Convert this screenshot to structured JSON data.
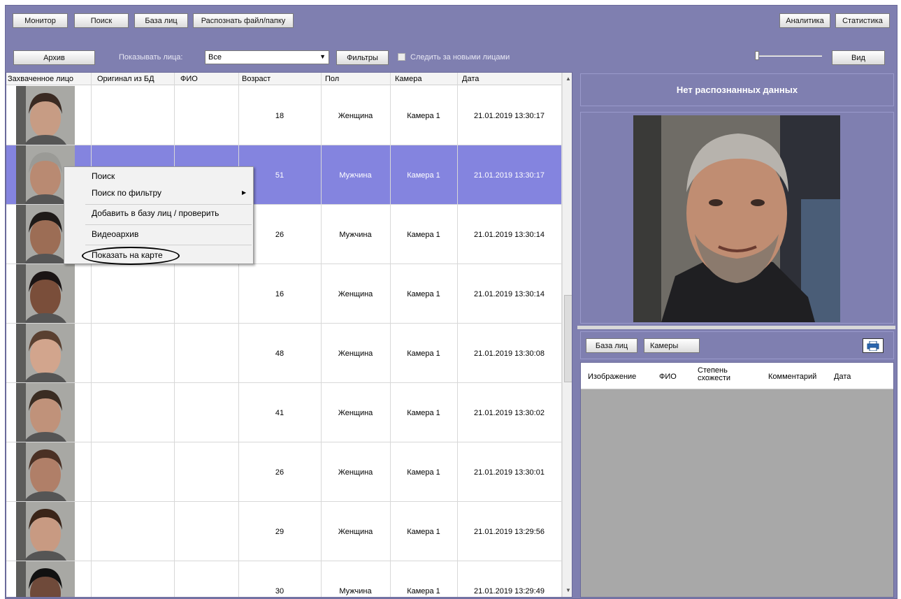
{
  "toolbar": {
    "monitor": "Монитор",
    "search": "Поиск",
    "face_db": "База лиц",
    "recognize": "Распознать файл/папку",
    "analytics": "Аналитика",
    "statistics": "Статистика"
  },
  "filterbar": {
    "archive": "Архив",
    "show_faces_label": "Показывать лица:",
    "show_faces_value": "Все",
    "filters": "Фильтры",
    "follow_new_label": "Следить за новыми лицами",
    "follow_new_checked": false,
    "view": "Вид"
  },
  "grid": {
    "columns": [
      "Захваченное лицо",
      "Оригинал из БД",
      "ФИО",
      "Возраст",
      "Пол",
      "Камера",
      "Дата"
    ],
    "rows": [
      {
        "age": "18",
        "gender": "Женщина",
        "camera": "Камера 1",
        "date": "21.01.2019 13:30:17"
      },
      {
        "age": "51",
        "gender": "Мужчина",
        "camera": "Камера 1",
        "date": "21.01.2019 13:30:17"
      },
      {
        "age": "26",
        "gender": "Мужчина",
        "camera": "Камера 1",
        "date": "21.01.2019 13:30:14"
      },
      {
        "age": "16",
        "gender": "Женщина",
        "camera": "Камера 1",
        "date": "21.01.2019 13:30:14"
      },
      {
        "age": "48",
        "gender": "Женщина",
        "camera": "Камера 1",
        "date": "21.01.2019 13:30:08"
      },
      {
        "age": "41",
        "gender": "Женщина",
        "camera": "Камера 1",
        "date": "21.01.2019 13:30:02"
      },
      {
        "age": "26",
        "gender": "Женщина",
        "camera": "Камера 1",
        "date": "21.01.2019 13:30:01"
      },
      {
        "age": "29",
        "gender": "Женщина",
        "camera": "Камера 1",
        "date": "21.01.2019 13:29:56"
      },
      {
        "age": "30",
        "gender": "Мужчина",
        "camera": "Камера 1",
        "date": "21.01.2019 13:29:49"
      }
    ],
    "selected_row": 1
  },
  "context_menu": {
    "items": [
      "Поиск",
      "Поиск по фильтру",
      "Добавить в базу лиц / проверить",
      "Видеоархив",
      "Показать на карте"
    ],
    "highlighted": "Показать на карте"
  },
  "right_panel": {
    "status": "Нет распознанных данных",
    "tabs": [
      "База лиц",
      "Камеры"
    ],
    "table_columns": [
      "Изображение",
      "ФИО",
      "Степень схожести",
      "Комментарий",
      "Дата"
    ],
    "print_icon": "printer-icon"
  },
  "colors": {
    "panel": "#7f7fb0",
    "selected_row": "#8484df"
  }
}
